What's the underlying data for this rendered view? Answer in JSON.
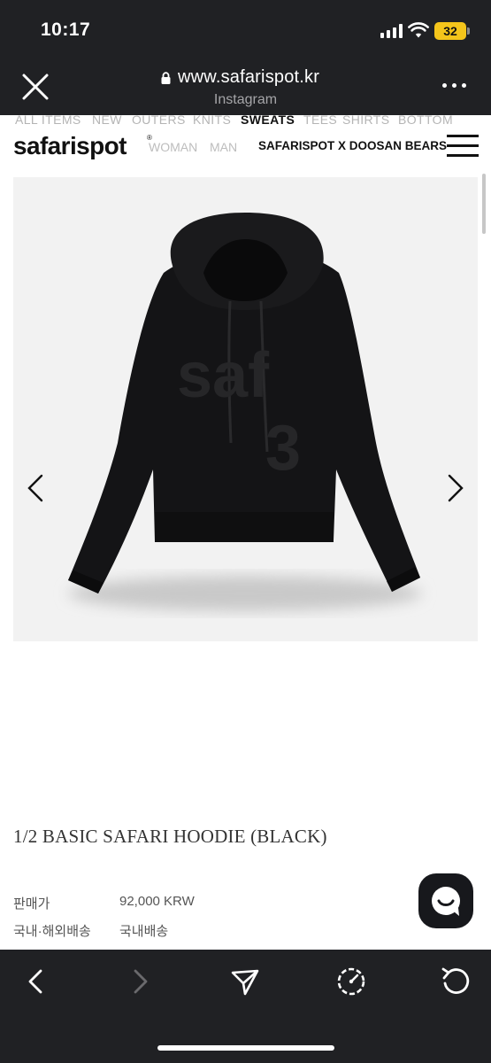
{
  "status_bar": {
    "time": "10:17",
    "battery": "32"
  },
  "browser": {
    "url": "www.safarispot.kr",
    "source": "Instagram"
  },
  "site": {
    "logo": "safarispot",
    "logo_mark": "®",
    "categories": [
      "ALL ITEMS",
      "NEW",
      "OUTERS",
      "KNITS",
      "SWEATS",
      "TEES",
      "SHIRTS",
      "BOTTOM"
    ],
    "active_category": "SWEATS",
    "sub_nav": [
      "WOMAN",
      "MAN"
    ],
    "collab": "SAFARISPOT X DOOSAN BEARS"
  },
  "product": {
    "title": "1/2 BASIC SAFARI HOODIE (BLACK)",
    "price_label": "판매가",
    "price_value": "92,000 KRW",
    "shipping_label": "국내·해외배송",
    "shipping_value": "국내배송",
    "print_text": "saf",
    "print_number": "3"
  },
  "icons": {
    "close": "close-icon",
    "lock": "lock-icon",
    "more": "more-icon",
    "menu": "hamburger-icon",
    "prev": "chevron-left-icon",
    "next": "chevron-right-icon",
    "chat": "chat-icon",
    "back": "back-icon",
    "forward": "forward-icon",
    "share": "share-icon",
    "compass": "compass-icon",
    "reload": "reload-icon"
  },
  "colors": {
    "browser_bar": "#202124",
    "battery": "#f4c51b",
    "product_bg": "#f2f2f2",
    "hoodie": "#141416"
  }
}
